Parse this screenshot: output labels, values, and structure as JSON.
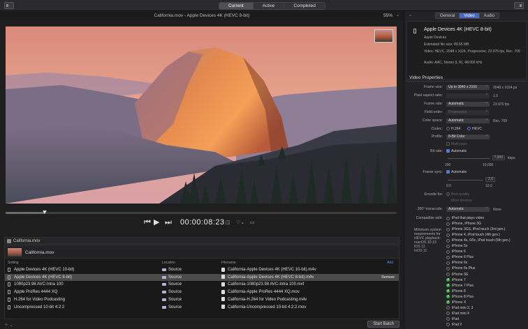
{
  "toolbar": {
    "tabs": [
      "Current",
      "Active",
      "Completed"
    ],
    "active_tab": "Current"
  },
  "viewer": {
    "title": "California.mov - Apple Devices 4K (HEVC 8-bit)",
    "zoom": "55%"
  },
  "transport": {
    "timecode": "00:00:08:23",
    "playhead_fraction": 0.1
  },
  "source": {
    "label": "California.mov"
  },
  "batch": {
    "file_name": "California.mov",
    "columns": {
      "setting": "Setting",
      "location": "Location",
      "filename": "Filename",
      "add": "Add"
    },
    "rows": [
      {
        "setting": "Apple Devices 4K (HEVC 10-bit)",
        "location": "Source",
        "filename": "California-Apple Devices 4K (HEVC 10-bit).m4v",
        "selected": false
      },
      {
        "setting": "Apple Devices 4K (HEVC 8-bit)",
        "location": "Source",
        "filename": "California-Apple Devices 4K (HEVC 8-bit).m4v",
        "selected": true
      },
      {
        "setting": "1080p23.98 AVC-Intra 100",
        "location": "Source",
        "filename": "California-1080p23.98 AVC-Intra 100.mxf",
        "selected": false
      },
      {
        "setting": "Apple ProRes 4444 XQ",
        "location": "Source",
        "filename": "California-Apple ProRes 4444 XQ.mov",
        "selected": false
      },
      {
        "setting": "H.264 for Video Podcasting",
        "location": "Source",
        "filename": "California-H.264 for Video Podcasting.m4v",
        "selected": false
      },
      {
        "setting": "Uncompressed 10-bit 4:2:2",
        "location": "Source",
        "filename": "California-Uncompressed 10-bit 4:2:2.mov",
        "selected": false
      }
    ],
    "remove_label": "Remove",
    "start_batch": "Start Batch"
  },
  "inspector": {
    "tabs": [
      "General",
      "Video",
      "Audio"
    ],
    "active_tab": "Video",
    "summary": {
      "title": "Apple Devices 4K (HEVC 8-bit)",
      "lines": [
        "Apple Devices",
        "Estimated file size: 89.65 MB",
        "Video: HEVC, 2048 x 1024, Progressive, 23.976 fps, Rec. 709",
        "Audio: AAC, Stereo (L R), 48.000 kHz"
      ]
    },
    "video_properties": {
      "title": "Video Properties",
      "frame_size": {
        "label": "Frame size:",
        "value": "Up to 3840 x 2160",
        "extra": "2048 x 1024 px"
      },
      "pixel_aspect": {
        "label": "Pixel aspect ratio:",
        "value": "",
        "extra": "1.0"
      },
      "frame_rate": {
        "label": "Frame rate:",
        "value": "Automatic",
        "extra": "23.976 fps"
      },
      "field_order": {
        "label": "Field order:",
        "value": "Progressive"
      },
      "color_space": {
        "label": "Color space:",
        "value": "Automatic",
        "extra": "Rec. 709"
      },
      "codec": {
        "label": "Codec:",
        "options": [
          "H.264",
          "HEVC"
        ],
        "selected": "HEVC"
      },
      "profile": {
        "label": "Profile:",
        "value": "8-Bit Color"
      },
      "multi_pass": "Multi-pass",
      "bit_rate": {
        "label": "Bit rate:",
        "value": "Automatic",
        "field": "7,000",
        "unit": "kbps",
        "min": "200",
        "max": "10,000"
      },
      "frame_sync": {
        "label": "Frame sync:",
        "value": "Automatic",
        "field": "2.0",
        "min": "0.0",
        "max": "10.0"
      },
      "encode_for": {
        "label": "Encode for:",
        "options": [
          "Best quality",
          "More devices"
        ]
      },
      "translate": {
        "label": "360° transcode:",
        "value": "Automatic",
        "extra": "None"
      },
      "compatible": {
        "label": "Compatible with:",
        "requirements": [
          "Minimum system",
          "requirements for",
          "HEVC playback:",
          "macOS 10.13",
          "iOS 11",
          "tvOS 11"
        ],
        "items": [
          {
            "name": "iPod that plays video",
            "ok": false
          },
          {
            "name": "iPhone, iPhone 3G",
            "ok": false
          },
          {
            "name": "iPhone 3GS, iPod touch (3rd gen.)",
            "ok": false
          },
          {
            "name": "iPhone 4, iPod touch (4th gen.)",
            "ok": false
          },
          {
            "name": "iPhone 4s, 6/5c, iPod touch (5th gen.)",
            "ok": false
          },
          {
            "name": "iPhone 5s",
            "ok": false
          },
          {
            "name": "iPhone 6",
            "ok": false
          },
          {
            "name": "iPhone 6 Plus",
            "ok": false
          },
          {
            "name": "iPhone 6s",
            "ok": false
          },
          {
            "name": "iPhone 6s Plus",
            "ok": false
          },
          {
            "name": "iPhone SE",
            "ok": false
          },
          {
            "name": "iPhone 7",
            "ok": true
          },
          {
            "name": "iPhone 7 Plus",
            "ok": true
          },
          {
            "name": "iPhone 8",
            "ok": true
          },
          {
            "name": "iPhone 8 Plus",
            "ok": true
          },
          {
            "name": "iPhone X",
            "ok": true
          },
          {
            "name": "iPad mini 2, 3",
            "ok": false
          },
          {
            "name": "iPad mini 4",
            "ok": false
          },
          {
            "name": "iPad",
            "ok": false
          },
          {
            "name": "iPad 2",
            "ok": false
          }
        ]
      }
    }
  },
  "colors": {
    "accent": "#4f7ae0",
    "ok": "#3fae4e",
    "background": "#1e1e1f"
  }
}
